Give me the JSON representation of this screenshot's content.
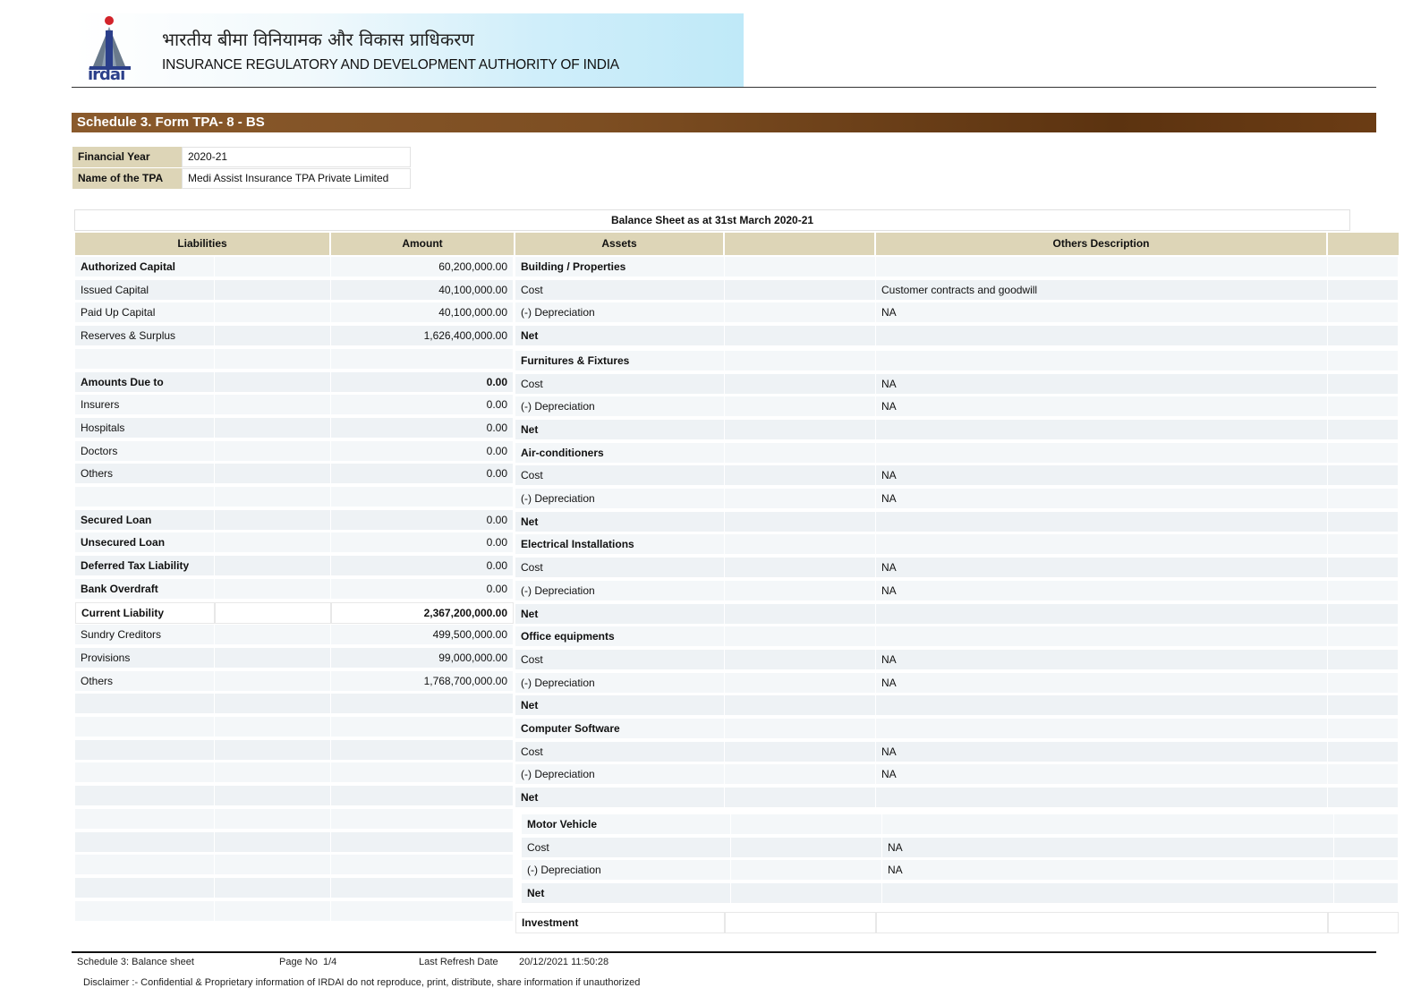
{
  "header": {
    "hindi_title": "भारतीय बीमा विनियामक और विकास प्राधिकरण",
    "english_title": "INSURANCE REGULATORY AND DEVELOPMENT AUTHORITY OF INDIA",
    "logo_text": "irdai"
  },
  "schedule_title": "Schedule 3. Form TPA- 8 - BS",
  "info": {
    "fy_label": "Financial Year",
    "fy_value": "2020-21",
    "tpa_label": "Name of the TPA",
    "tpa_value": "Medi Assist Insurance TPA Private Limited"
  },
  "balance_sheet": {
    "title": "Balance Sheet as at 31st March 2020-21",
    "headers": {
      "liabilities": "Liabilities",
      "amount": "Amount",
      "assets": "Assets",
      "others_description": "Others Description"
    },
    "liabilities": [
      {
        "label": "Authorized Capital",
        "amount": "60,200,000.00",
        "bold": true
      },
      {
        "label": "Issued Capital",
        "amount": "40,100,000.00",
        "bold": false
      },
      {
        "label": "Paid Up Capital",
        "amount": "40,100,000.00",
        "bold": false
      },
      {
        "label": "Reserves & Surplus",
        "amount": "1,626,400,000.00",
        "bold": false
      },
      {
        "label": "",
        "amount": "",
        "bold": false
      },
      {
        "label": "Amounts Due to",
        "amount": "0.00",
        "bold": true
      },
      {
        "label": "Insurers",
        "amount": "0.00",
        "bold": false
      },
      {
        "label": "Hospitals",
        "amount": "0.00",
        "bold": false
      },
      {
        "label": "Doctors",
        "amount": "0.00",
        "bold": false
      },
      {
        "label": "Others",
        "amount": "0.00",
        "bold": false
      },
      {
        "label": "",
        "amount": "",
        "bold": false
      },
      {
        "label": "Secured Loan",
        "amount": "0.00",
        "bold": true
      },
      {
        "label": "Unsecured Loan",
        "amount": "0.00",
        "bold": true
      },
      {
        "label": "Deferred Tax Liability",
        "amount": "0.00",
        "bold": true
      },
      {
        "label": "Bank Overdraft",
        "amount": "0.00",
        "bold": true
      },
      {
        "label": "Current Liability",
        "amount": "2,367,200,000.00",
        "bold": true
      },
      {
        "label": "Sundry Creditors",
        "amount": "499,500,000.00",
        "bold": false
      },
      {
        "label": "Provisions",
        "amount": "99,000,000.00",
        "bold": false
      },
      {
        "label": "Others",
        "amount": "1,768,700,000.00",
        "bold": false
      }
    ],
    "assets": [
      {
        "label": "Building / Properties",
        "desc": "",
        "bold": true
      },
      {
        "label": "Cost",
        "desc": "Customer contracts and goodwill",
        "bold": false
      },
      {
        "label": "(-) Depreciation",
        "desc": "NA",
        "bold": false
      },
      {
        "label": "Net",
        "desc": "",
        "bold": true
      },
      {
        "label": "Furnitures & Fixtures",
        "desc": "",
        "bold": true
      },
      {
        "label": "Cost",
        "desc": "NA",
        "bold": false
      },
      {
        "label": "(-) Depreciation",
        "desc": "NA",
        "bold": false
      },
      {
        "label": "Net",
        "desc": "",
        "bold": true
      },
      {
        "label": "Air-conditioners",
        "desc": "",
        "bold": true
      },
      {
        "label": "Cost",
        "desc": "NA",
        "bold": false
      },
      {
        "label": "(-) Depreciation",
        "desc": "NA",
        "bold": false
      },
      {
        "label": "Net",
        "desc": "",
        "bold": true
      },
      {
        "label": "Electrical Installations",
        "desc": "",
        "bold": true
      },
      {
        "label": "Cost",
        "desc": "NA",
        "bold": false
      },
      {
        "label": "(-) Depreciation",
        "desc": "NA",
        "bold": false
      },
      {
        "label": "Net",
        "desc": "",
        "bold": true
      },
      {
        "label": "Office equipments",
        "desc": "",
        "bold": true
      },
      {
        "label": "Cost",
        "desc": "NA",
        "bold": false
      },
      {
        "label": "(-) Depreciation",
        "desc": "NA",
        "bold": false
      },
      {
        "label": "Net",
        "desc": "",
        "bold": true
      },
      {
        "label": "Computer Software",
        "desc": "",
        "bold": true
      },
      {
        "label": "Cost",
        "desc": "NA",
        "bold": false
      },
      {
        "label": "(-) Depreciation",
        "desc": "NA",
        "bold": false
      },
      {
        "label": "Net",
        "desc": "",
        "bold": true
      }
    ],
    "motor_vehicle": [
      {
        "label": "Motor Vehicle",
        "desc": "",
        "bold": true
      },
      {
        "label": "Cost",
        "desc": "NA",
        "bold": false
      },
      {
        "label": "(-) Depreciation",
        "desc": "NA",
        "bold": false
      },
      {
        "label": "Net",
        "desc": "",
        "bold": true
      }
    ],
    "investment_label": "Investment"
  },
  "footer": {
    "schedule": "Schedule 3: Balance sheet",
    "page_label": "Page No",
    "page_value": "1/4",
    "refresh_label": "Last Refresh Date",
    "refresh_value": "20/12/2021 11:50:28",
    "disclaimer": "Disclaimer :- Confidential & Proprietary information of IRDAI do not reproduce, print, distribute, share information if unauthorized"
  }
}
